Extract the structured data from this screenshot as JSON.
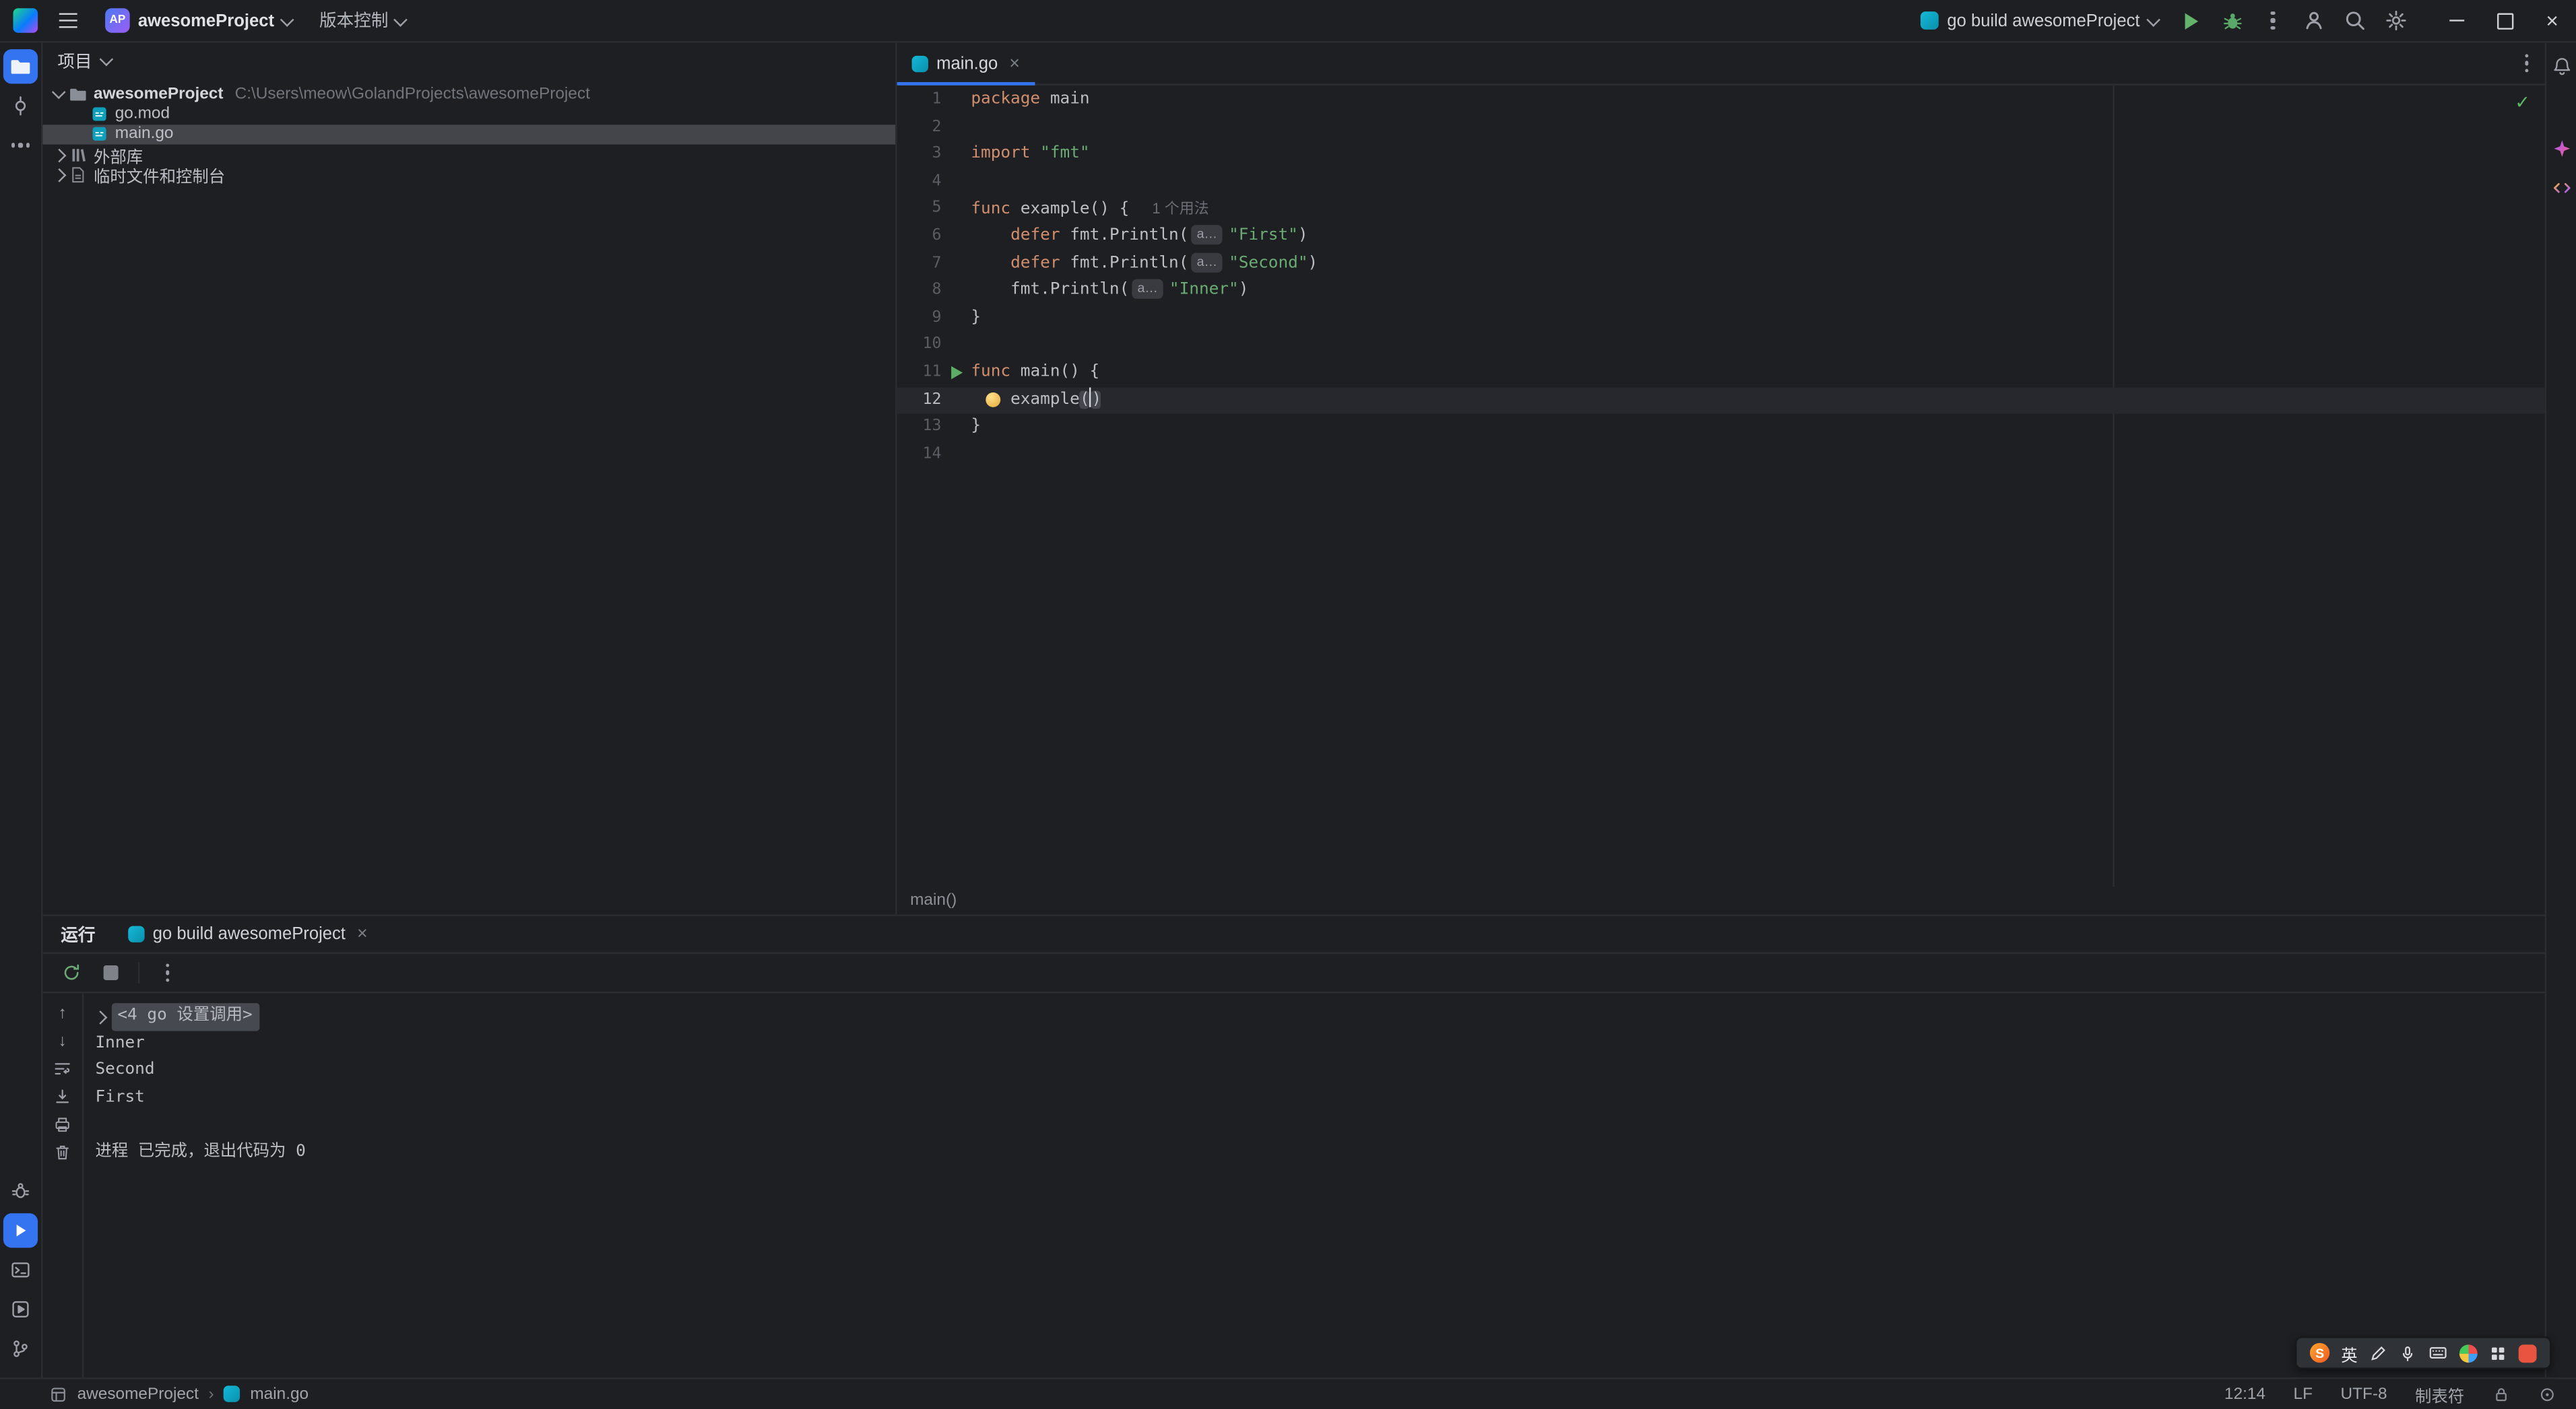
{
  "titlebar": {
    "project_badge": "AP",
    "project_name": "awesomeProject",
    "vcs_label": "版本控制",
    "run_config": "go build awesomeProject"
  },
  "icons": {
    "check": "✓",
    "close": "×",
    "arrow_up": "↑",
    "arrow_down": "↓"
  },
  "project_panel": {
    "title": "项目",
    "items": [
      {
        "label": "awesomeProject",
        "path": "C:\\Users\\meow\\GolandProjects\\awesomeProject",
        "icon": "folder",
        "chevron": "down",
        "indent": 0,
        "bold": true
      },
      {
        "label": "go.mod",
        "icon": "go-file",
        "indent": 1
      },
      {
        "label": "main.go",
        "icon": "go-file",
        "indent": 1,
        "selected": true
      },
      {
        "label": "外部库",
        "icon": "library",
        "chevron": "right",
        "indent": 0
      },
      {
        "label": "临时文件和控制台",
        "icon": "scratch",
        "chevron": "right",
        "indent": 0
      }
    ]
  },
  "editor": {
    "tab": {
      "label": "main.go"
    },
    "breadcrumb": "main()",
    "lines": [
      {
        "tokens": [
          [
            "kw",
            "package"
          ],
          [
            "pl",
            " main"
          ]
        ]
      },
      {
        "tokens": []
      },
      {
        "tokens": [
          [
            "kw",
            "import"
          ],
          [
            "pl",
            " "
          ],
          [
            "str",
            "\"fmt\""
          ]
        ]
      },
      {
        "tokens": []
      },
      {
        "tokens": [
          [
            "kw",
            "func"
          ],
          [
            "pl",
            " example() {"
          ],
          [
            "hint",
            "1 个用法"
          ]
        ]
      },
      {
        "tokens": [
          [
            "pl",
            "    "
          ],
          [
            "kw",
            "defer"
          ],
          [
            "pl",
            " fmt.Println("
          ],
          [
            "chip",
            "a…"
          ],
          [
            "str",
            "\"First\""
          ],
          [
            "pl",
            ")"
          ]
        ]
      },
      {
        "tokens": [
          [
            "pl",
            "    "
          ],
          [
            "kw",
            "defer"
          ],
          [
            "pl",
            " fmt.Println("
          ],
          [
            "chip",
            "a…"
          ],
          [
            "str",
            "\"Second\""
          ],
          [
            "pl",
            ")"
          ]
        ]
      },
      {
        "tokens": [
          [
            "pl",
            "    fmt.Println("
          ],
          [
            "chip",
            "a…"
          ],
          [
            "str",
            "\"Inner\""
          ],
          [
            "pl",
            ")"
          ]
        ]
      },
      {
        "tokens": [
          [
            "pl",
            "}"
          ]
        ]
      },
      {
        "tokens": []
      },
      {
        "run": true,
        "tokens": [
          [
            "kw",
            "func"
          ],
          [
            "pl",
            " main() {"
          ]
        ]
      },
      {
        "current": true,
        "bulb": true,
        "tokens": [
          [
            "pl",
            "    example"
          ],
          [
            "match",
            "("
          ],
          [
            "caret",
            ""
          ],
          [
            "match",
            ")"
          ]
        ]
      },
      {
        "tokens": [
          [
            "pl",
            "}"
          ]
        ]
      },
      {
        "tokens": []
      }
    ]
  },
  "run_panel": {
    "title": "运行",
    "tab": "go build awesomeProject",
    "console": [
      {
        "fold": true,
        "text": "<4 go 设置调用>"
      },
      {
        "text": "Inner"
      },
      {
        "text": "Second"
      },
      {
        "text": "First"
      },
      {
        "text": ""
      },
      {
        "text": "进程 已完成，退出代码为 0"
      }
    ]
  },
  "status_bar": {
    "project": "awesomeProject",
    "separator": "›",
    "file": "main.go",
    "caret_position": "12:14",
    "line_separator": "LF",
    "encoding": "UTF-8",
    "indent_style": "制表符"
  },
  "ime_bar": {
    "logo": "S",
    "mode": "英"
  }
}
